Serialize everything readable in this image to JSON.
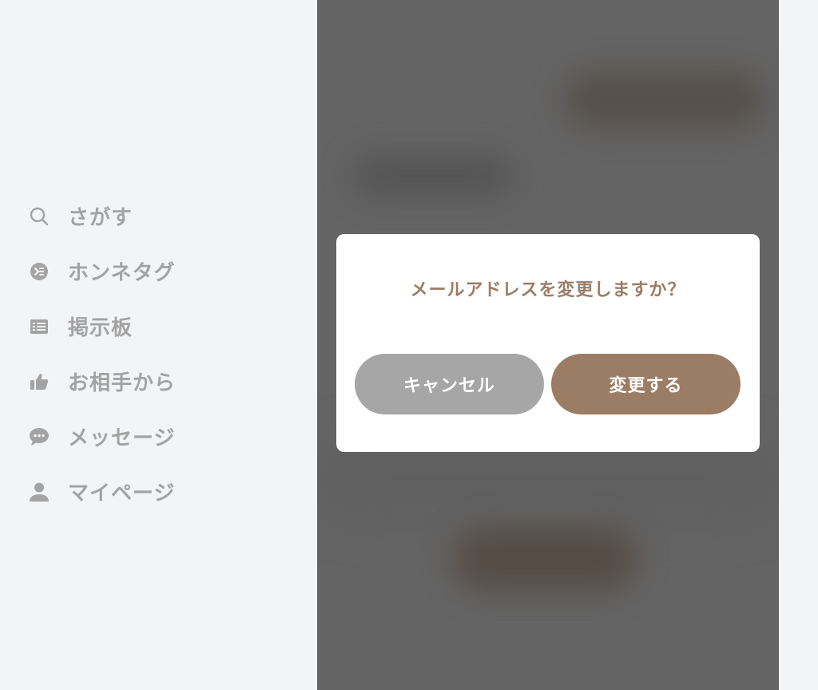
{
  "sidebar": {
    "items": [
      {
        "label": "さがす",
        "icon": "search-icon"
      },
      {
        "label": "ホンネタグ",
        "icon": "tag-icon"
      },
      {
        "label": "掲示板",
        "icon": "board-icon"
      },
      {
        "label": "お相手から",
        "icon": "thumbs-up-icon"
      },
      {
        "label": "メッセージ",
        "icon": "chat-bubble-icon"
      },
      {
        "label": "マイページ",
        "icon": "person-icon"
      }
    ]
  },
  "modal": {
    "title": "メールアドレスを変更しますか？",
    "cancel_label": "キャンセル",
    "confirm_label": "変更する"
  },
  "colors": {
    "accent": "#9b7d66",
    "cancel": "#a6a6a6",
    "nav_text": "#a3a3a3",
    "background": "#f3f4f6",
    "overlay": "#646464"
  }
}
